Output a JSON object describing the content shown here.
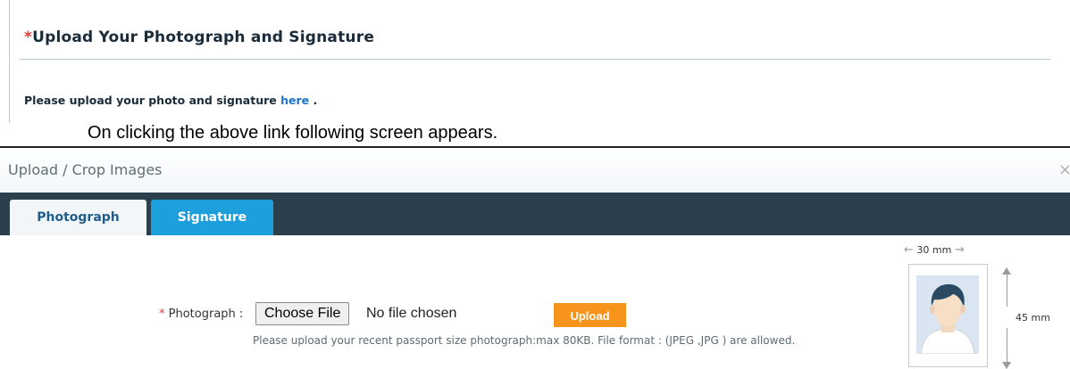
{
  "section": {
    "required_mark": "*",
    "title": "Upload Your Photograph and Signature",
    "message_prefix": "Please upload your photo and signature ",
    "link_text": "here",
    "message_suffix": " ."
  },
  "caption": "On clicking the above link following screen appears.",
  "dialog": {
    "title": "Upload / Crop Images",
    "close": "×",
    "tabs": [
      {
        "label": "Photograph",
        "active": true
      },
      {
        "label": "Signature",
        "active": false
      }
    ],
    "form": {
      "required_mark": "*",
      "label": "Photograph :",
      "file_button": "Choose File",
      "file_status": "No file chosen",
      "upload_button": "Upload",
      "hint": "Please upload your recent passport size photograph:max 80KB. File format : (JPEG ,JPG ) are allowed."
    },
    "sample": {
      "width_label": "30 mm",
      "height_label": "45 mm"
    }
  },
  "colors": {
    "tabbar": "#2b3f4d",
    "active_tab": "#f2f6f9",
    "inactive_tab": "#1c9fdc",
    "upload_button": "#f7941d",
    "link": "#1a73c8",
    "required": "#e53935"
  }
}
